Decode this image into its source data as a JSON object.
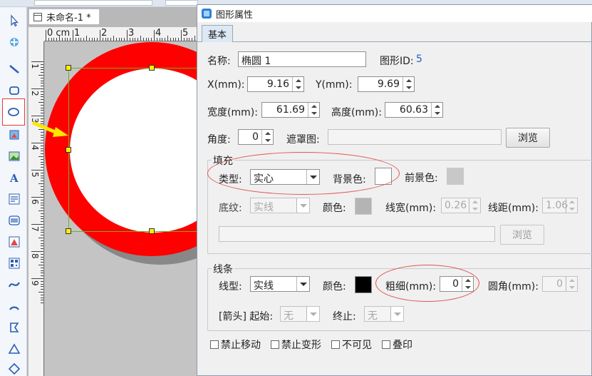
{
  "document": {
    "tab_title": "未命名-1 *",
    "ruler_top_labels": [
      "0 cm",
      "1",
      "2",
      "3",
      "4",
      "5"
    ],
    "ruler_left_labels": [
      "1",
      "2",
      "3",
      "4",
      "5",
      "6",
      "7",
      "8",
      "9"
    ]
  },
  "toolbar": {
    "tools": [
      "select-arrow-icon",
      "pan-icon",
      "line-icon",
      "rounded-rectangle-icon",
      "ellipse-icon",
      "image-icon",
      "picture-icon",
      "text-icon",
      "rich-text-icon",
      "barcode-icon",
      "shape-icon",
      "qrcode-icon",
      "curve-icon",
      "arc-icon",
      "polyline-icon",
      "triangle-icon",
      "diamond-icon"
    ],
    "active_tool": "ellipse-icon"
  },
  "dialog": {
    "title": "图形属性",
    "tab": "基本",
    "name_label": "名称:",
    "name_value": "椭圆 1",
    "id_label": "图形ID:",
    "id_value": "5",
    "x_label": "X(mm):",
    "x_value": "9.16",
    "y_label": "Y(mm):",
    "y_value": "9.69",
    "width_label": "宽度(mm):",
    "width_value": "61.69",
    "height_label": "高度(mm):",
    "height_value": "60.63",
    "angle_label": "角度:",
    "angle_value": "0",
    "mask_label": "遮罩图:",
    "mask_value": "",
    "browse_label": "浏览",
    "fill": {
      "group_title": "填充",
      "type_label": "类型:",
      "type_value": "实心",
      "bg_color_label": "背景色:",
      "bg_color": "#ffffff",
      "fg_color_label": "前景色:",
      "fg_color": "#c8c8c8",
      "pattern_label": "底纹:",
      "pattern_value": "实线",
      "color_label": "颜色:",
      "color": "#b4b4b4",
      "line_width_label": "线宽(mm):",
      "line_width_value": "0.26",
      "line_spacing_label": "线距(mm):",
      "line_spacing_value": "1.06",
      "image_path": "",
      "browse_label": "浏览"
    },
    "line": {
      "group_title": "线条",
      "type_label": "线型:",
      "type_value": "实线",
      "color_label": "颜色:",
      "color": "#000000",
      "thickness_label": "粗细(mm):",
      "thickness_value": "0",
      "corner_label": "圆角(mm):",
      "corner_value": "0",
      "arrow_label": "[箭头] 起始:",
      "arrow_start": "无",
      "arrow_end_label": "终止:",
      "arrow_end": "无"
    },
    "checkboxes": [
      "禁止移动",
      "禁止变形",
      "不可见",
      "叠印"
    ]
  },
  "colors": {
    "ring": "#ff0000",
    "selection": "#6fae2d",
    "annotation": "#e05555"
  }
}
